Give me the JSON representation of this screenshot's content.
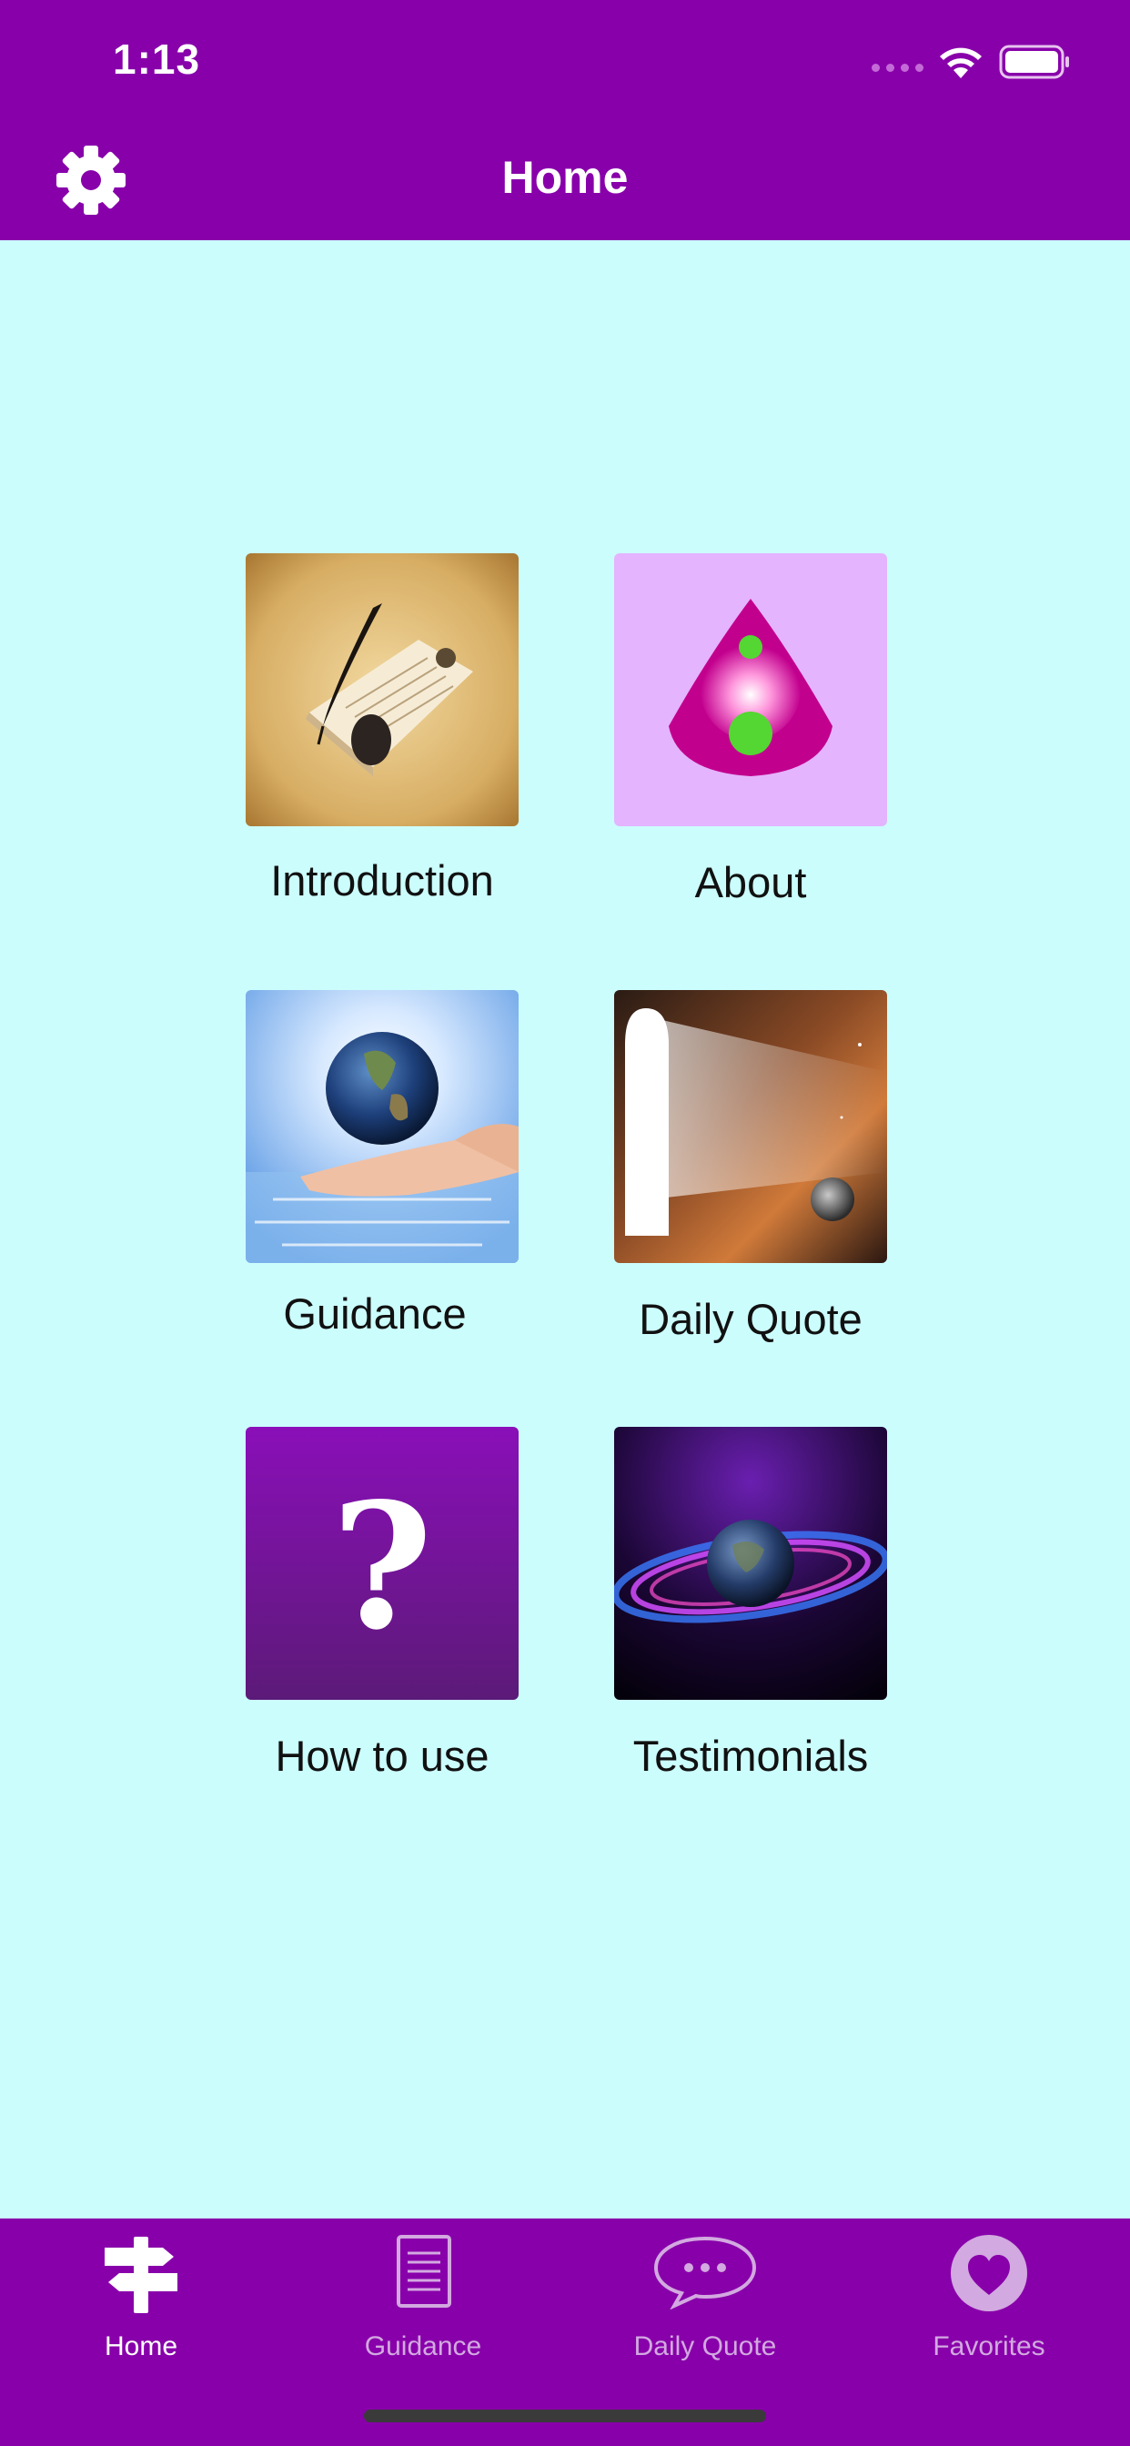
{
  "status_bar": {
    "time": "1:13"
  },
  "nav": {
    "title": "Home"
  },
  "grid": [
    {
      "label": "Introduction"
    },
    {
      "label": "About"
    },
    {
      "label": "Guidance"
    },
    {
      "label": "Daily Quote"
    },
    {
      "label": "How to use"
    },
    {
      "label": "Testimonials"
    }
  ],
  "tab_bar": {
    "items": [
      {
        "label": "Home",
        "icon": "signpost-icon",
        "active": true
      },
      {
        "label": "Guidance",
        "icon": "document-icon",
        "active": false
      },
      {
        "label": "Daily Quote",
        "icon": "speech-bubble-icon",
        "active": false
      },
      {
        "label": "Favorites",
        "icon": "heart-icon",
        "active": false
      }
    ]
  },
  "colors": {
    "primary": "#8800aa",
    "background": "#ccfdfd"
  }
}
